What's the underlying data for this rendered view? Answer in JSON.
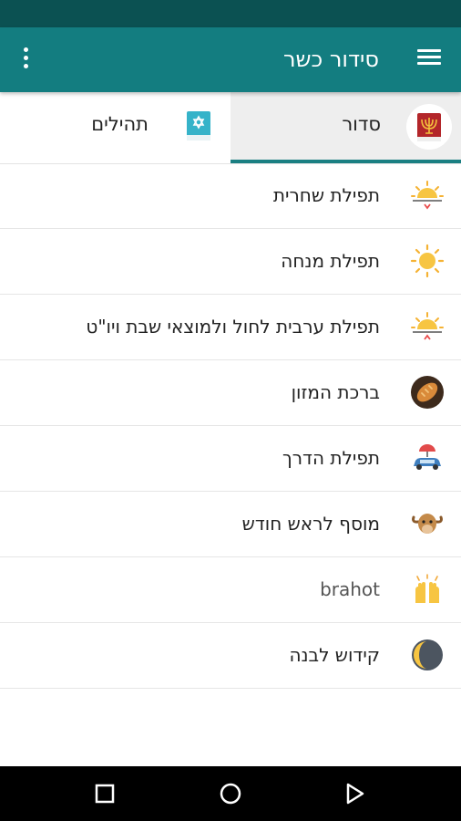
{
  "app": {
    "title": "סידור כשר"
  },
  "tabs": [
    {
      "label": "סדור",
      "icon": "menorah-book-icon",
      "active": true
    },
    {
      "label": "תהילים",
      "icon": "star-of-david-book-icon",
      "active": false
    }
  ],
  "items": [
    {
      "label": "תפילת שחרית",
      "icon": "sunrise-icon"
    },
    {
      "label": "תפילת מנחה",
      "icon": "sun-icon"
    },
    {
      "label": "תפילת ערבית לחול ולמוצאי שבת ויו\"ט",
      "icon": "sunset-icon"
    },
    {
      "label": "ברכת המזון",
      "icon": "bread-icon"
    },
    {
      "label": "תפילת הדרך",
      "icon": "car-umbrella-icon"
    },
    {
      "label": "מוסף לראש חודש",
      "icon": "ram-icon"
    },
    {
      "label": "brahot",
      "icon": "raised-hands-icon"
    },
    {
      "label": "קידוש לבנה",
      "icon": "moon-icon"
    }
  ],
  "colors": {
    "status_bar": "#0b5152",
    "app_bar": "#137d80",
    "tab_indicator": "#1a7f82"
  },
  "navbar": {
    "buttons": [
      "back-icon",
      "home-icon",
      "recents-icon"
    ]
  }
}
